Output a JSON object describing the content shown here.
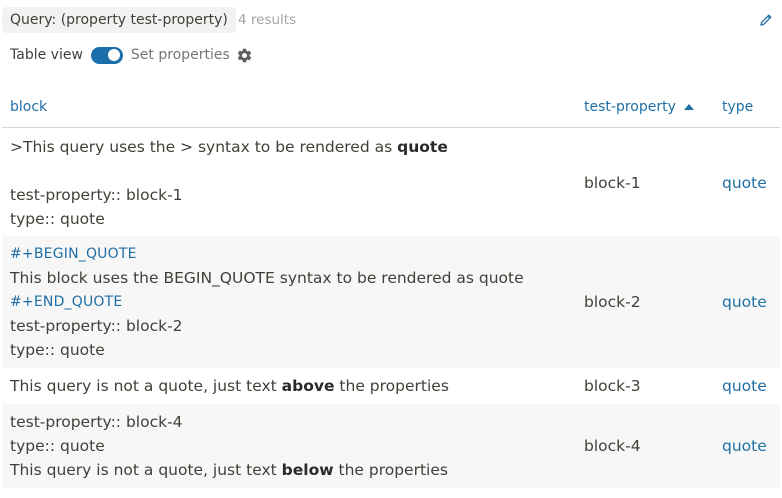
{
  "header": {
    "query_label": "Query: (property test-property)",
    "results_count": "4 results",
    "edit_icon": "pencil-icon"
  },
  "toolbar": {
    "table_view_label": "Table view",
    "table_view_enabled": true,
    "set_properties_label": "Set properties",
    "settings_icon": "gear-icon"
  },
  "table": {
    "columns": [
      {
        "key": "block",
        "label": "block"
      },
      {
        "key": "test-property",
        "label": "test-property",
        "sort": "ascending"
      },
      {
        "key": "type",
        "label": "type"
      }
    ],
    "rows": [
      {
        "block": {
          "quote_prefix": ">This query uses the > syntax to be rendered as ",
          "quote_bold": "quote",
          "prop_line": "test-property:: block-1",
          "type_line": "type:: quote"
        },
        "test_property": "block-1",
        "type": "quote"
      },
      {
        "block": {
          "begin_marker": "#+BEGIN_QUOTE",
          "text": "This block uses the BEGIN_QUOTE syntax to be rendered as quote",
          "end_marker": "#+END_QUOTE",
          "prop_line": "test-property:: block-2",
          "type_line": "type:: quote"
        },
        "test_property": "block-2",
        "type": "quote"
      },
      {
        "block": {
          "text_prefix": "This query is not a quote, just text ",
          "text_bold": "above",
          "text_suffix": " the properties"
        },
        "test_property": "block-3",
        "type": "quote"
      },
      {
        "block": {
          "prop_line": "test-property:: block-4",
          "type_line": "type:: quote",
          "text_prefix": "This query is not a quote, just text ",
          "text_bold": "below",
          "text_suffix": " the properties"
        },
        "test_property": "block-4",
        "type": "quote"
      }
    ]
  },
  "colors": {
    "accent": "#1f6fa5",
    "toggle_on": "#1a6fab",
    "row_alt_bg": "#f7f7f7",
    "chip_bg": "#f2f2f2",
    "muted_text": "#a3a3a3"
  }
}
